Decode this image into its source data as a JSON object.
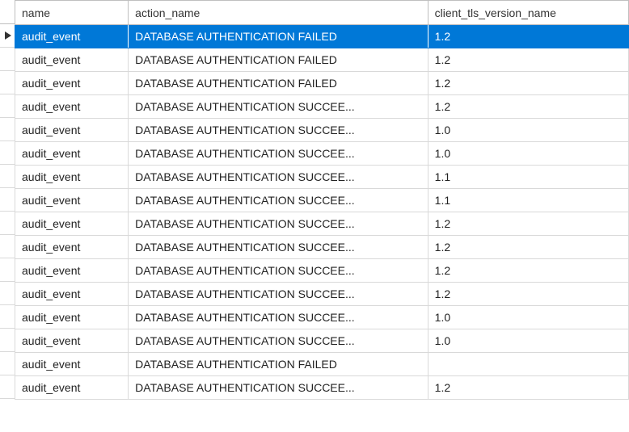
{
  "grid": {
    "columns": [
      {
        "key": "name",
        "label": "name"
      },
      {
        "key": "action_name",
        "label": "action_name"
      },
      {
        "key": "client_tls_version_name",
        "label": "client_tls_version_name"
      }
    ],
    "selected_row_index": 0,
    "rows": [
      {
        "name": "audit_event",
        "action_name": "DATABASE AUTHENTICATION FAILED",
        "client_tls_version_name": "1.2"
      },
      {
        "name": "audit_event",
        "action_name": "DATABASE AUTHENTICATION FAILED",
        "client_tls_version_name": "1.2"
      },
      {
        "name": "audit_event",
        "action_name": "DATABASE AUTHENTICATION FAILED",
        "client_tls_version_name": "1.2"
      },
      {
        "name": "audit_event",
        "action_name": "DATABASE AUTHENTICATION SUCCEE...",
        "client_tls_version_name": "1.2"
      },
      {
        "name": "audit_event",
        "action_name": "DATABASE AUTHENTICATION SUCCEE...",
        "client_tls_version_name": "1.0"
      },
      {
        "name": "audit_event",
        "action_name": "DATABASE AUTHENTICATION SUCCEE...",
        "client_tls_version_name": "1.0"
      },
      {
        "name": "audit_event",
        "action_name": "DATABASE AUTHENTICATION SUCCEE...",
        "client_tls_version_name": "1.1"
      },
      {
        "name": "audit_event",
        "action_name": "DATABASE AUTHENTICATION SUCCEE...",
        "client_tls_version_name": "1.1"
      },
      {
        "name": "audit_event",
        "action_name": "DATABASE AUTHENTICATION SUCCEE...",
        "client_tls_version_name": "1.2"
      },
      {
        "name": "audit_event",
        "action_name": "DATABASE AUTHENTICATION SUCCEE...",
        "client_tls_version_name": "1.2"
      },
      {
        "name": "audit_event",
        "action_name": "DATABASE AUTHENTICATION SUCCEE...",
        "client_tls_version_name": "1.2"
      },
      {
        "name": "audit_event",
        "action_name": "DATABASE AUTHENTICATION SUCCEE...",
        "client_tls_version_name": "1.2"
      },
      {
        "name": "audit_event",
        "action_name": "DATABASE AUTHENTICATION SUCCEE...",
        "client_tls_version_name": "1.0"
      },
      {
        "name": "audit_event",
        "action_name": "DATABASE AUTHENTICATION SUCCEE...",
        "client_tls_version_name": "1.0"
      },
      {
        "name": "audit_event",
        "action_name": "DATABASE AUTHENTICATION FAILED",
        "client_tls_version_name": ""
      },
      {
        "name": "audit_event",
        "action_name": "DATABASE AUTHENTICATION SUCCEE...",
        "client_tls_version_name": "1.2"
      }
    ]
  }
}
